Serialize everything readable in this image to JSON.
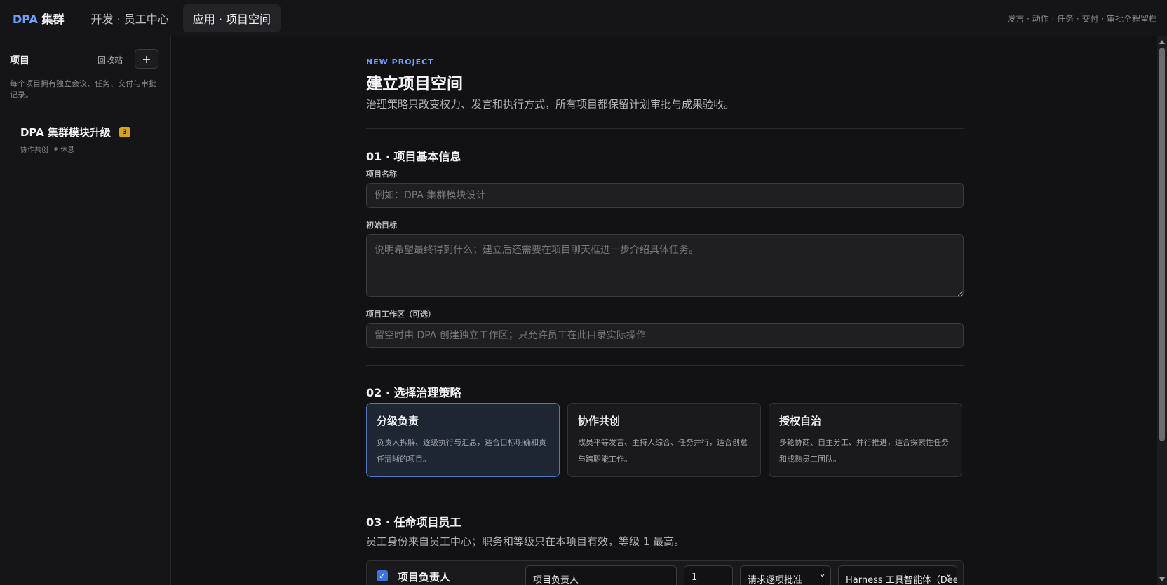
{
  "topbar": {
    "brand_accent": "DPA",
    "brand_rest": " 集群",
    "tab_dev": "开发 · 员工中心",
    "tab_app": "应用 · 项目空间",
    "right_text": "发言 · 动作 · 任务 · 交付 · 审批全程留档"
  },
  "sidebar": {
    "title": "项目",
    "recycle": "回收站",
    "add": "+",
    "description": "每个项目拥有独立会议、任务、交付与审批记录。",
    "projects": [
      {
        "name": "DPA 集群模块升级",
        "badge": "3",
        "mode": "协作共创",
        "status": "休息"
      }
    ]
  },
  "main": {
    "eyebrow": "NEW PROJECT",
    "title": "建立项目空间",
    "subtitle": "治理策略只改变权力、发言和执行方式，所有项目都保留计划审批与成果验收。",
    "section1": {
      "title": "01 · 项目基本信息",
      "name_label": "项目名称",
      "name_placeholder": "例如：DPA 集群模块设计",
      "goal_label": "初始目标",
      "goal_placeholder": "说明希望最终得到什么；建立后还需要在项目聊天框进一步介绍具体任务。",
      "workspace_label": "项目工作区（可选）",
      "workspace_placeholder": "留空时由 DPA 创建独立工作区；只允许员工在此目录实际操作"
    },
    "section2": {
      "title": "02 · 选择治理策略",
      "strategies": [
        {
          "title": "分级负责",
          "desc": "负责人拆解、逐级执行与汇总，适合目标明确和责任清晰的项目。",
          "selected": true
        },
        {
          "title": "协作共创",
          "desc": "成员平等发言、主持人综合、任务并行，适合创意与跨职能工作。",
          "selected": false
        },
        {
          "title": "授权自治",
          "desc": "多轮协商、自主分工、并行推进，适合探索性任务和成熟员工团队。",
          "selected": false
        }
      ]
    },
    "section3": {
      "title": "03 · 任命项目员工",
      "desc": "员工身份来自员工中心；职务和等级只在本项目有效，等级 1 最高。",
      "member": {
        "checked": true,
        "label": "项目负责人",
        "role_value": "项目负责人",
        "level_value": "1",
        "approval_value": "请求逐项批准",
        "agent_value": "Harness 工具智能体（Deep"
      }
    }
  },
  "colors": {
    "accent": "#6ea0ff",
    "badge": "#d9a514",
    "selected_border": "#4f79c4",
    "checkbox": "#3b73d9"
  }
}
